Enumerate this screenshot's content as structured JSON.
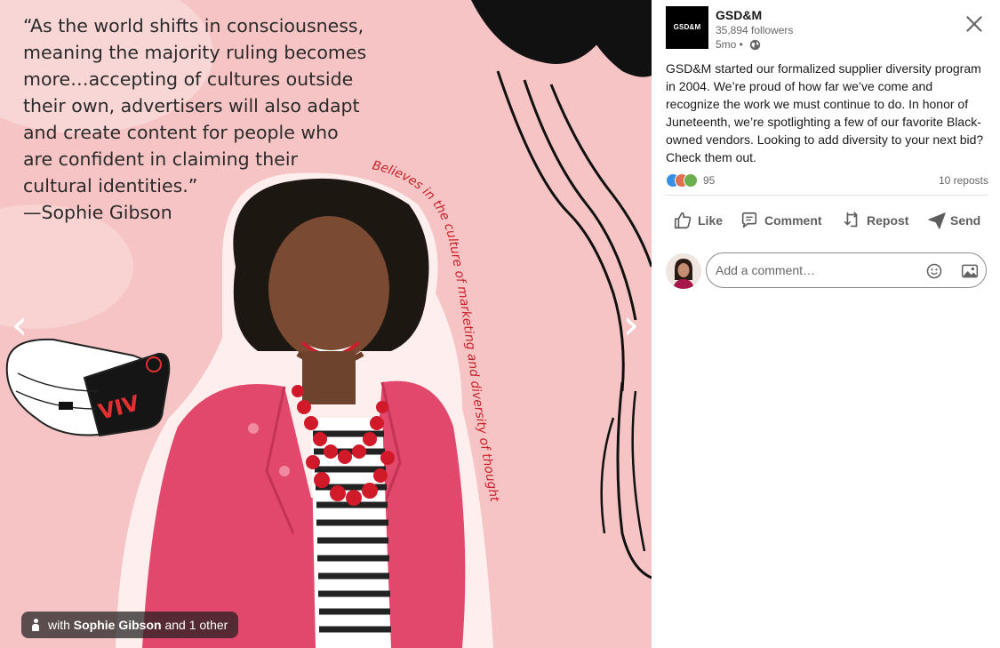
{
  "media": {
    "quote_lines": [
      "“As the world shifts in consciousness,",
      "meaning the majority ruling becomes",
      "more…accepting of cultures outside",
      "their own, advertisers will also adapt",
      "and create content for people who",
      "are confident in claiming their",
      "cultural identities.”",
      "—Sophie Gibson"
    ],
    "curved_text": "Believes in the culture of marketing and diversity of thought",
    "headset_logo": "VIV",
    "prev_arrow": "‹",
    "next_arrow": "›",
    "tag": {
      "prefix": "with",
      "name": "Sophie Gibson",
      "suffix": "and 1 other"
    },
    "colors": {
      "background": "#f6c4c4",
      "jacket": "#e2486b",
      "accent_red": "#c8202a"
    }
  },
  "post": {
    "company_logo_text": "GSD&M",
    "company": "GSD&M",
    "followers": "35,894 followers",
    "age": "5mo •",
    "body": "GSD&M started our formalized supplier diversity program in 2004. We’re proud of how far we’ve come and recognize the work we must continue to do. In honor of Juneteenth, we’re spotlighting a few of our favorite Black-owned vendors. Looking to add diversity to your next bid? Check them out.",
    "reaction_count": "95",
    "reposts": "10 reposts",
    "actions": {
      "like": "Like",
      "comment": "Comment",
      "repost": "Repost",
      "send": "Send"
    },
    "comment_placeholder": "Add a comment…",
    "icons": [
      "close-icon",
      "globe-icon",
      "like-icon",
      "comment-icon",
      "repost-icon",
      "send-icon",
      "emoji-icon",
      "image-icon"
    ]
  }
}
